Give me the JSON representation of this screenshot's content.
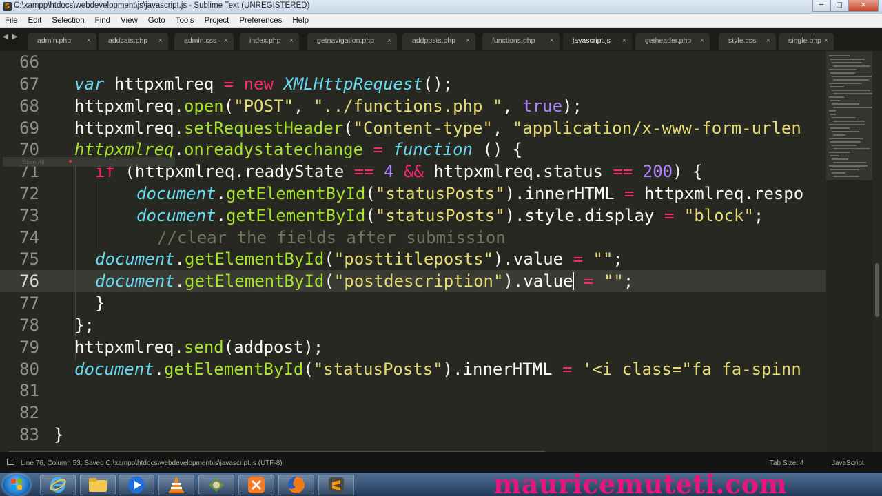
{
  "window": {
    "title": "C:\\xampp\\htdocs\\webdevelopment\\js\\javascript.js - Sublime Text (UNREGISTERED)",
    "controls": [
      "minimize",
      "maximize",
      "close"
    ]
  },
  "menu": [
    "File",
    "Edit",
    "Selection",
    "Find",
    "View",
    "Goto",
    "Tools",
    "Project",
    "Preferences",
    "Help"
  ],
  "tabs": [
    {
      "label": "admin.php",
      "active": false
    },
    {
      "label": "addcats.php",
      "active": false
    },
    {
      "label": "admin.css",
      "active": false
    },
    {
      "label": "index.php",
      "active": false
    },
    {
      "label": "getnavigation.php",
      "active": false
    },
    {
      "label": "addposts.php",
      "active": false
    },
    {
      "label": "functions.php",
      "active": false
    },
    {
      "label": "javascript.js",
      "active": true
    },
    {
      "label": "getheader.php",
      "active": false
    },
    {
      "label": "style.css",
      "active": false
    },
    {
      "label": "single.php",
      "active": false
    }
  ],
  "editor": {
    "current_line": 76,
    "line_numbers": [
      "66",
      "67",
      "68",
      "69",
      "70",
      "71",
      "72",
      "73",
      "74",
      "75",
      "76",
      "77",
      "78",
      "79",
      "80",
      "81",
      "82",
      "83"
    ],
    "tooltip": "Save All"
  },
  "status": {
    "left": "Line 76, Column 53; Saved C:\\xampp\\htdocs\\webdevelopment\\js\\javascript.js (UTF-8)",
    "tab_size": "Tab Size: 4",
    "syntax": "JavaScript"
  },
  "taskbar": {
    "apps": [
      "internet-explorer-icon",
      "file-explorer-icon",
      "media-player-icon",
      "vlc-icon",
      "app-icon",
      "xampp-icon",
      "firefox-icon",
      "sublime-text-icon"
    ],
    "watermark": "mauricemuteti.com"
  },
  "colors": {
    "background": "#272822",
    "keyword": "#f92672",
    "string": "#e6db74",
    "function": "#a6e22e",
    "storage": "#66d9ef",
    "number": "#ae81ff",
    "comment": "#75715e",
    "watermark": "#e8157a"
  }
}
